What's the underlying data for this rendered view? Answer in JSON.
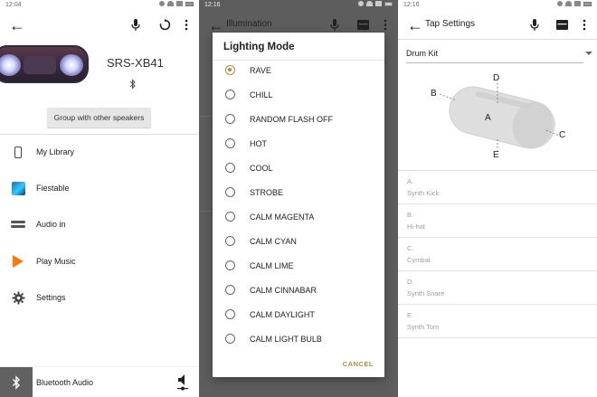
{
  "panel1": {
    "status": {
      "time": "12:04"
    },
    "speaker_model": "SRS-XB41",
    "group_button_label": "Group with other speakers",
    "menu": [
      {
        "label": "My Library",
        "icon": "phone-icon"
      },
      {
        "label": "Fiestable",
        "icon": "fiestable-icon"
      },
      {
        "label": "Audio in",
        "icon": "audio-in-icon"
      },
      {
        "label": "Play Music",
        "icon": "play-music-icon"
      },
      {
        "label": "Settings",
        "icon": "gear-icon"
      }
    ],
    "bottom_bar_label": "Bluetooth Audio"
  },
  "panel2": {
    "status": {
      "time": "12:16"
    },
    "toolbar_title": "Illumination",
    "dialog": {
      "title": "Lighting Mode",
      "options": [
        "RAVE",
        "CHILL",
        "RANDOM FLASH OFF",
        "HOT",
        "COOL",
        "STROBE",
        "CALM MAGENTA",
        "CALM CYAN",
        "CALM LIME",
        "CALM CINNABAR",
        "CALM DAYLIGHT",
        "CALM LIGHT BULB"
      ],
      "selected_index": 0,
      "cancel_label": "CANCEL",
      "accent_color": "#b08a3e"
    }
  },
  "panel3": {
    "status": {
      "time": "12:16"
    },
    "toolbar_title": "Tap Settings",
    "dropdown_value": "Drum Kit",
    "diagram_labels": {
      "a": "A",
      "b": "B",
      "c": "C",
      "d": "D",
      "e": "E"
    },
    "assignments": [
      {
        "letter": "A.",
        "sound": "Synth Kick"
      },
      {
        "letter": "B.",
        "sound": "Hi-hat"
      },
      {
        "letter": "C.",
        "sound": "Cymbal"
      },
      {
        "letter": "D.",
        "sound": "Synth Snare"
      },
      {
        "letter": "E.",
        "sound": "Synth Tom"
      }
    ]
  }
}
